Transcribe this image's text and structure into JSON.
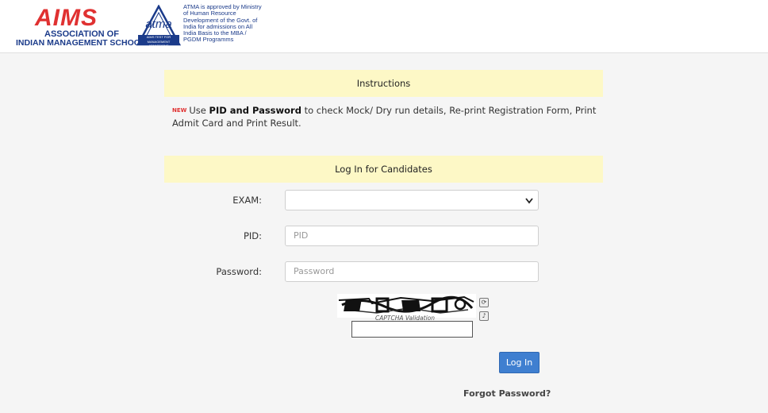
{
  "header": {
    "aims_mark": "AIMS",
    "aims_line1": "ASSOCIATION OF",
    "aims_line2": "INDIAN MANAGEMENT SCHOOLS",
    "atma_text": "atma",
    "atma_tag": "AIMS TEST FOR MANAGEMENT ADMISSIONS",
    "atma_description": "ATMA is approved by Ministry of Human Resource Development of the Govt. of India for admissions on All India Basis to the MBA / PGDM Programms"
  },
  "instructions": {
    "title": "Instructions",
    "badge": "NEW",
    "text_prefix": "Use ",
    "text_bold": "PID and Password",
    "text_suffix": " to check Mock/ Dry run details, Re-print Registration Form, Print Admit Card and Print Result."
  },
  "login": {
    "title": "Log In for Candidates",
    "exam_label": "EXAM:",
    "exam_selected": "",
    "pid_label": "PID:",
    "pid_placeholder": "PID",
    "password_label": "Password:",
    "password_placeholder": "Password",
    "captcha_label": "CAPTCHA Validation",
    "button_label": "Log In",
    "forgot_label": "Forgot Password?"
  },
  "icons": {
    "chevron": "chevron-down-icon",
    "refresh": "refresh-icon",
    "audio": "audio-icon"
  },
  "colors": {
    "brand_red": "#e03131",
    "brand_blue": "#1b3b8a",
    "panel_yellow": "#fdf8c6",
    "button_blue": "#3f7fd0"
  }
}
